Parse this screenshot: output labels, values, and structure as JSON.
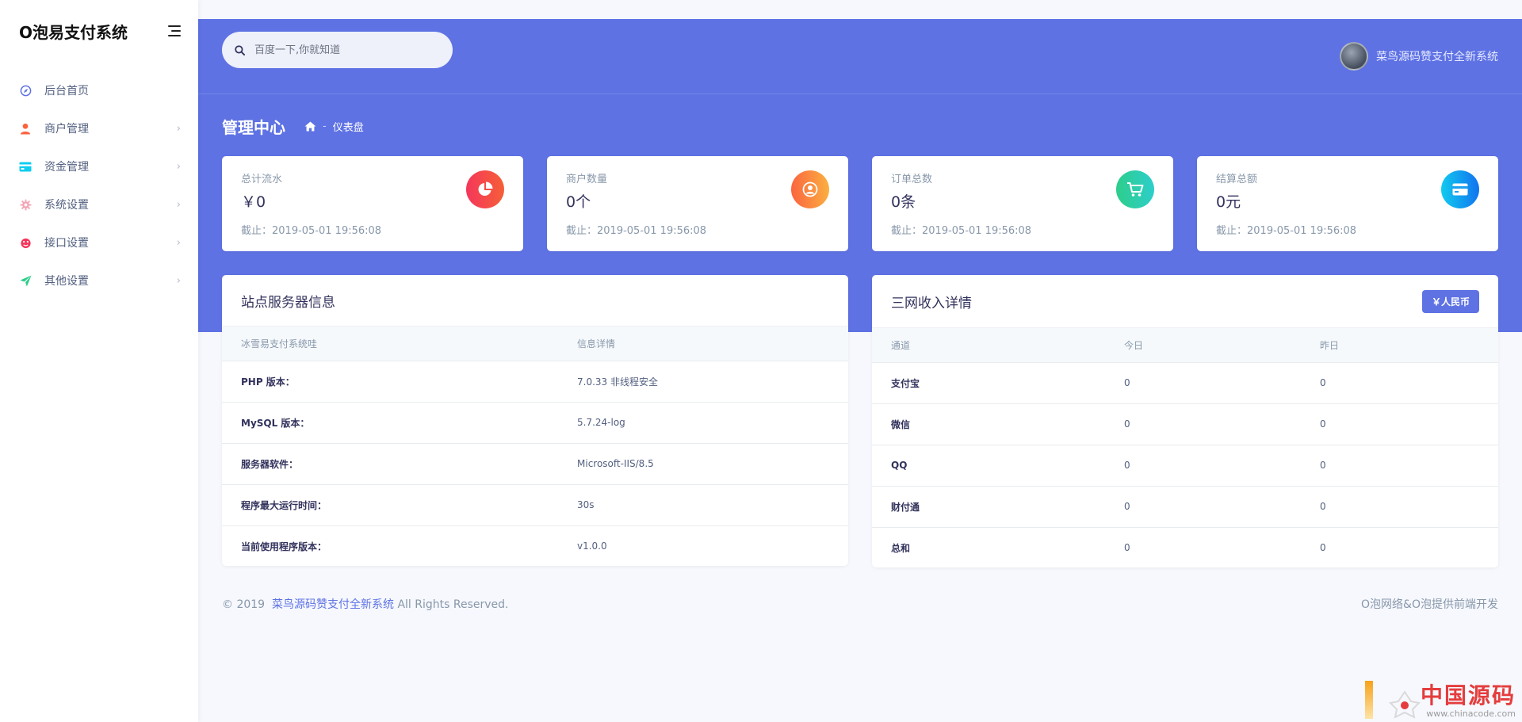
{
  "app": {
    "brand": "O泡易支付系统"
  },
  "sidebar": {
    "items": [
      {
        "label": "后台首页",
        "icon": "compass-icon",
        "has_children": false
      },
      {
        "label": "商户管理",
        "icon": "user-icon",
        "has_children": true
      },
      {
        "label": "资金管理",
        "icon": "credit-card-icon",
        "has_children": true
      },
      {
        "label": "系统设置",
        "icon": "gear-icon",
        "has_children": true
      },
      {
        "label": "接口设置",
        "icon": "plug-icon",
        "has_children": true
      },
      {
        "label": "其他设置",
        "icon": "paper-plane-icon",
        "has_children": true
      }
    ],
    "arrow": "›"
  },
  "header": {
    "search_placeholder": "百度一下,你就知道",
    "user_name": "菜鸟源码赞支付全新系统"
  },
  "page": {
    "title": "管理中心",
    "breadcrumb_current": "仪表盘",
    "breadcrumb_sep": "-"
  },
  "stats": [
    {
      "label": "总计流水",
      "value": "￥0",
      "time": "截止：2019-05-01 19:56:08",
      "icon": "pie-chart-icon",
      "color_from": "#f5365c",
      "color_to": "#f56036"
    },
    {
      "label": "商户数量",
      "value": "0个",
      "time": "截止：2019-05-01 19:56:08",
      "icon": "user-circle-icon",
      "color_from": "#fb6340",
      "color_to": "#fbb140"
    },
    {
      "label": "订单总数",
      "value": "0条",
      "time": "截止：2019-05-01 19:56:08",
      "icon": "cart-icon",
      "color_from": "#2dce89",
      "color_to": "#2dcecc"
    },
    {
      "label": "结算总额",
      "value": "0元",
      "time": "截止：2019-05-01 19:56:08",
      "icon": "card-icon",
      "color_from": "#11cdef",
      "color_to": "#1171ef"
    }
  ],
  "server_panel": {
    "title": "站点服务器信息",
    "headers": [
      "冰雪易支付系统哇",
      "信息详情"
    ],
    "rows": [
      [
        "PHP 版本：",
        "7.0.33 非线程安全"
      ],
      [
        "MySQL 版本：",
        "5.7.24-log"
      ],
      [
        "服务器软件：",
        "Microsoft-IIS/8.5"
      ],
      [
        "程序最大运行时间：",
        "30s"
      ],
      [
        "当前使用程序版本：",
        "v1.0.0"
      ]
    ]
  },
  "income_panel": {
    "title": "三网收入详情",
    "badge": "￥人民币",
    "headers": [
      "通道",
      "今日",
      "昨日"
    ],
    "rows": [
      [
        "支付宝",
        "0",
        "0"
      ],
      [
        "微信",
        "0",
        "0"
      ],
      [
        "QQ",
        "0",
        "0"
      ],
      [
        "财付通",
        "0",
        "0"
      ],
      [
        "总和",
        "0",
        "0"
      ]
    ]
  },
  "footer": {
    "copyright_prefix": "© 2019",
    "link_text": "菜鸟源码赞支付全新系统",
    "copyright_suffix": "All Rights Reserved.",
    "right_text": "O泡网络&O泡提供前端开发"
  },
  "watermark": {
    "title": "中国源码",
    "url": "www.chinacode.com"
  },
  "colors": {
    "primary": "#5e72e4",
    "sidebar_bg": "#ffffff",
    "page_bg": "#f6f8fd"
  }
}
